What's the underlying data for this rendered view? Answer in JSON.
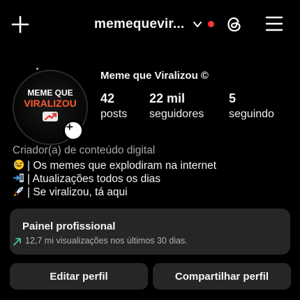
{
  "header": {
    "username": "memequevir...",
    "notification_dot_color": "#ff3040"
  },
  "profile": {
    "avatar_text_line1": "MEME QUE",
    "avatar_text_line2": "VIRALIZOU",
    "display_name": "Meme que Viralizou ©",
    "stats": [
      {
        "value": "42",
        "label": "posts"
      },
      {
        "value": "22 mil",
        "label": "seguidores"
      },
      {
        "value": "5",
        "label": "seguindo"
      }
    ],
    "category": "Criador(a) de conteúdo digital",
    "bio": [
      {
        "icon": "laughing-emoji-icon",
        "text": "| Os memes que explodiram na internet"
      },
      {
        "icon": "phone-arrow-emoji-icon",
        "text": "| Atualizações todos os dias"
      },
      {
        "icon": "rocket-emoji-icon",
        "text": "| Se viralizou, tá aqui"
      }
    ]
  },
  "professional_panel": {
    "title": "Painel profissional",
    "subtitle": "12,7 mi visualizações nos últimos 30 dias.",
    "trend_color": "#3ecf8e"
  },
  "actions": {
    "edit_profile": "Editar perfil",
    "share_profile": "Compartilhar perfil"
  }
}
